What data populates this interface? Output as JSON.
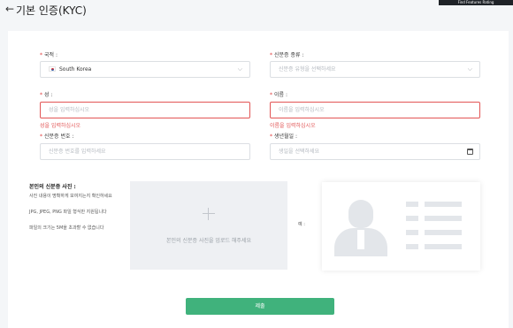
{
  "header": {
    "back_icon": "←",
    "title": "기본 인증(KYC)",
    "badge": "Find Features Rating"
  },
  "form": {
    "country": {
      "label": "국적 :",
      "value": "South Korea",
      "flag": "kr-flag-icon"
    },
    "id_type": {
      "label": "신분증 종류 :",
      "placeholder": "신분증 유형을 선택하세요"
    },
    "last_name": {
      "label": "성 :",
      "placeholder": "성을 입력하십시오",
      "error": "성을 입력하십시오"
    },
    "first_name": {
      "label": "이름 :",
      "placeholder": "이름을 입력하십시오",
      "error": "이름을 입력하십시오"
    },
    "id_number": {
      "label": "신분증 번호 :",
      "placeholder": "신분증 번호를 입력하세요"
    },
    "birth_date": {
      "label": "생년월일 :",
      "placeholder": "생일을 선택하세요"
    },
    "required_mark": "*",
    "dropdown_icon": "⌵"
  },
  "upload": {
    "title": "본인의 신분증 사진 :",
    "hints": [
      "사진 내용이 명확하게 보여지는지 확인하세요",
      "JPG, JPEG, PNG 파일 형식만 지원됩니다",
      "파일의 크기는 5M을 초과할 수 없습니다"
    ],
    "area_text": "본인의 신분증 사진을 업로드 해주세요",
    "example_label": "예 :"
  },
  "submit_label": "제출",
  "colors": {
    "accent": "#40b27c",
    "error": "#e25555",
    "required": "#e03b3b"
  }
}
